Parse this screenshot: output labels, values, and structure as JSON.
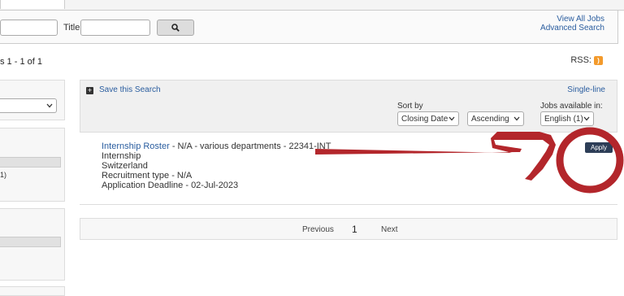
{
  "search": {
    "title_label": "Title",
    "search_icon": "search-icon"
  },
  "links": {
    "view_all": "View All Jobs",
    "advanced": "Advanced Search"
  },
  "results": {
    "count_text": "s 1 - 1 of 1",
    "rss_label": "RSS:"
  },
  "toolbar": {
    "save_search": "Save this Search",
    "single_line": "Single-line",
    "sort_by_label": "Sort by",
    "sort_field": "Closing Date",
    "sort_order": "Ascending",
    "jobs_available_label": "Jobs available in:",
    "language": "English (1)"
  },
  "sidebar": {
    "facet_count": "1)"
  },
  "job": {
    "title": "Internship Roster",
    "details": " - N/A - various departments - 22341-INT",
    "type": "Internship",
    "location": "Switzerland",
    "recruitment": "Recruitment type - N/A",
    "deadline": "Application Deadline - 02-Jul-2023",
    "apply_label": "Apply"
  },
  "pagination": {
    "previous": "Previous",
    "current": "1",
    "next": "Next"
  },
  "annotation": {
    "color": "#b3262b"
  }
}
